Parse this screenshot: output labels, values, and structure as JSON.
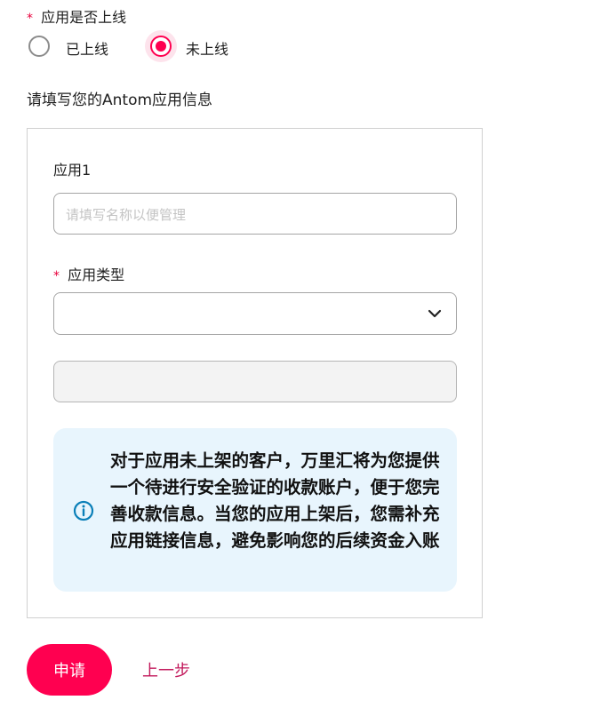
{
  "colors": {
    "accent": "#ff0050",
    "link": "#c2185b",
    "info_bg": "#e8f5fd",
    "info_icon": "#0a7fb8"
  },
  "app_online": {
    "required_mark": "*",
    "label": "应用是否上线",
    "options": [
      {
        "label": "已上线",
        "checked": false
      },
      {
        "label": "未上线",
        "checked": true
      }
    ]
  },
  "section_title": "请填写您的Antom应用信息",
  "app_card": {
    "title": "应用1",
    "name_input": {
      "placeholder": "请填写名称以便管理",
      "value": ""
    },
    "type_field": {
      "required_mark": "*",
      "label": "应用类型",
      "value": "",
      "icon": "chevron-down-icon"
    },
    "disabled_input": {
      "value": ""
    },
    "notice": {
      "icon": "info-icon",
      "text": "对于应用未上架的客户，万里汇将为您提供一个待进行安全验证的收款账户，便于您完善收款信息。当您的应用上架后，您需补充应用链接信息，避免影响您的后续资金入账"
    }
  },
  "actions": {
    "submit_label": "申请",
    "back_label": "上一步"
  }
}
